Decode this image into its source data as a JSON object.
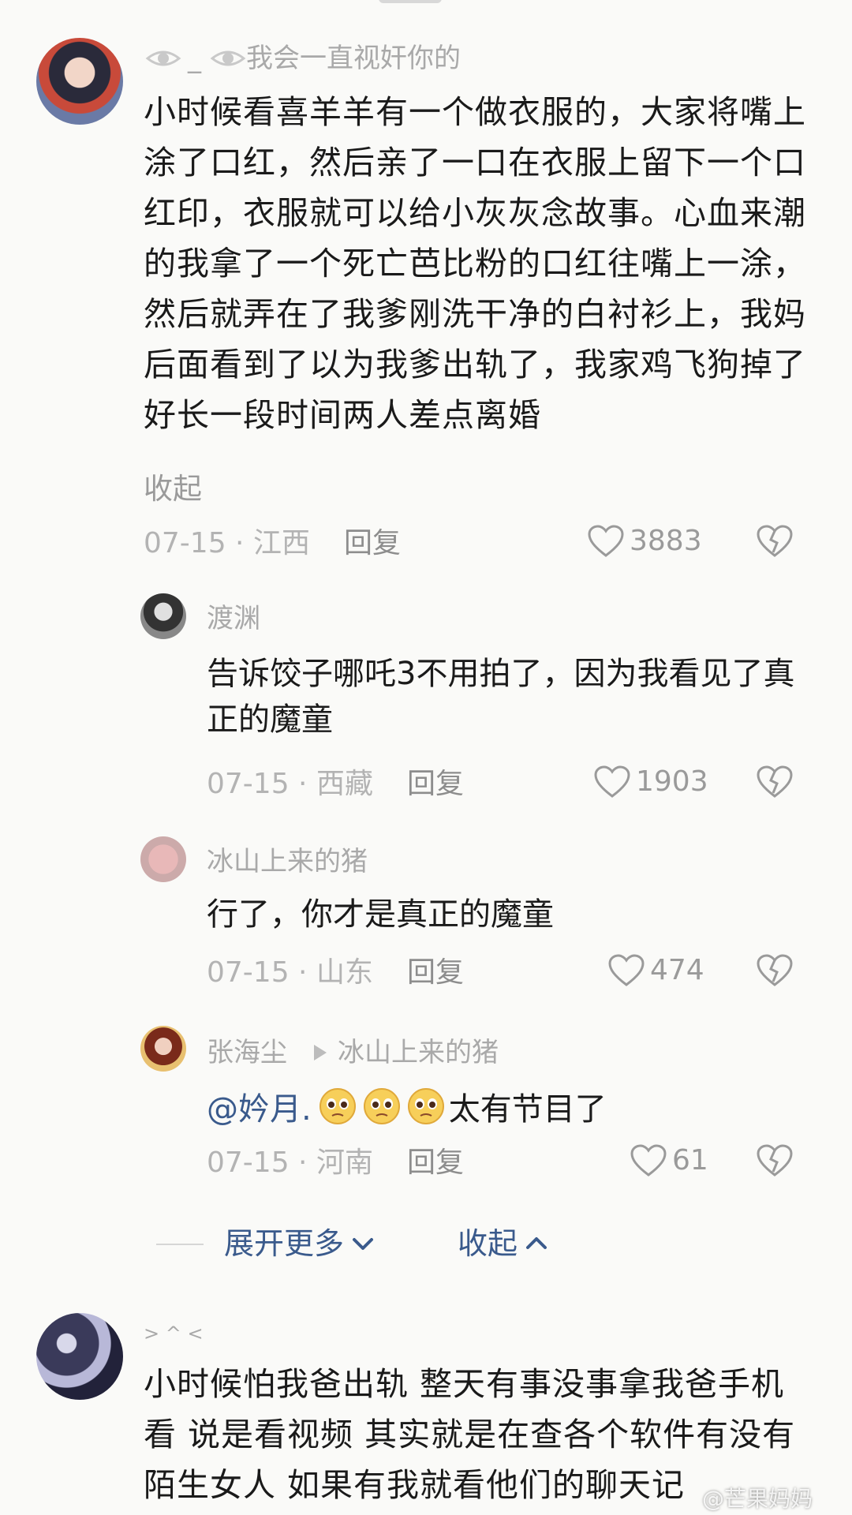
{
  "comment1": {
    "username": "我会一直视奸你的",
    "username_prefix": "_",
    "text": "小时候看喜羊羊有一个做衣服的，大家将嘴上涂了口红，然后亲了一口在衣服上留下一个口红印，衣服就可以给小灰灰念故事。心血来潮的我拿了一个死亡芭比粉的口红往嘴上一涂，然后就弄在了我爹刚洗干净的白衬衫上，我妈后面看到了以为我爹出轨了，我家鸡飞狗掉了好长一段时间两人差点离婚",
    "collapse": "收起",
    "date": "07-15 · 江西",
    "reply": "回复",
    "likes": "3883"
  },
  "reply1": {
    "username": "渡渊",
    "text": "告诉饺子哪吒3不用拍了，因为我看见了真正的魔童",
    "date": "07-15 · 西藏",
    "reply": "回复",
    "likes": "1903"
  },
  "reply2": {
    "username": "冰山上来的猪",
    "text": "行了，你才是真正的魔童",
    "date": "07-15 · 山东",
    "reply": "回复",
    "likes": "474"
  },
  "reply3": {
    "username": "张海尘",
    "reply_to": "冰山上来的猪",
    "mention": "@妗月.",
    "text": "太有节目了",
    "date": "07-15 · 河南",
    "reply": "回复",
    "likes": "61"
  },
  "expand": {
    "more": "展开更多",
    "collapse": "收起"
  },
  "comment2": {
    "username": "> ^ <",
    "text": "小时候怕我爸出轨 整天有事没事拿我爸手机看 说是看视频 其实就是在查各个软件有没有陌生女人 如果有我就看他们的聊天记",
    "watermark": "@芒果妈妈"
  },
  "colors": {
    "link": "#3a5a8c",
    "gray": "#a9a9a9"
  }
}
